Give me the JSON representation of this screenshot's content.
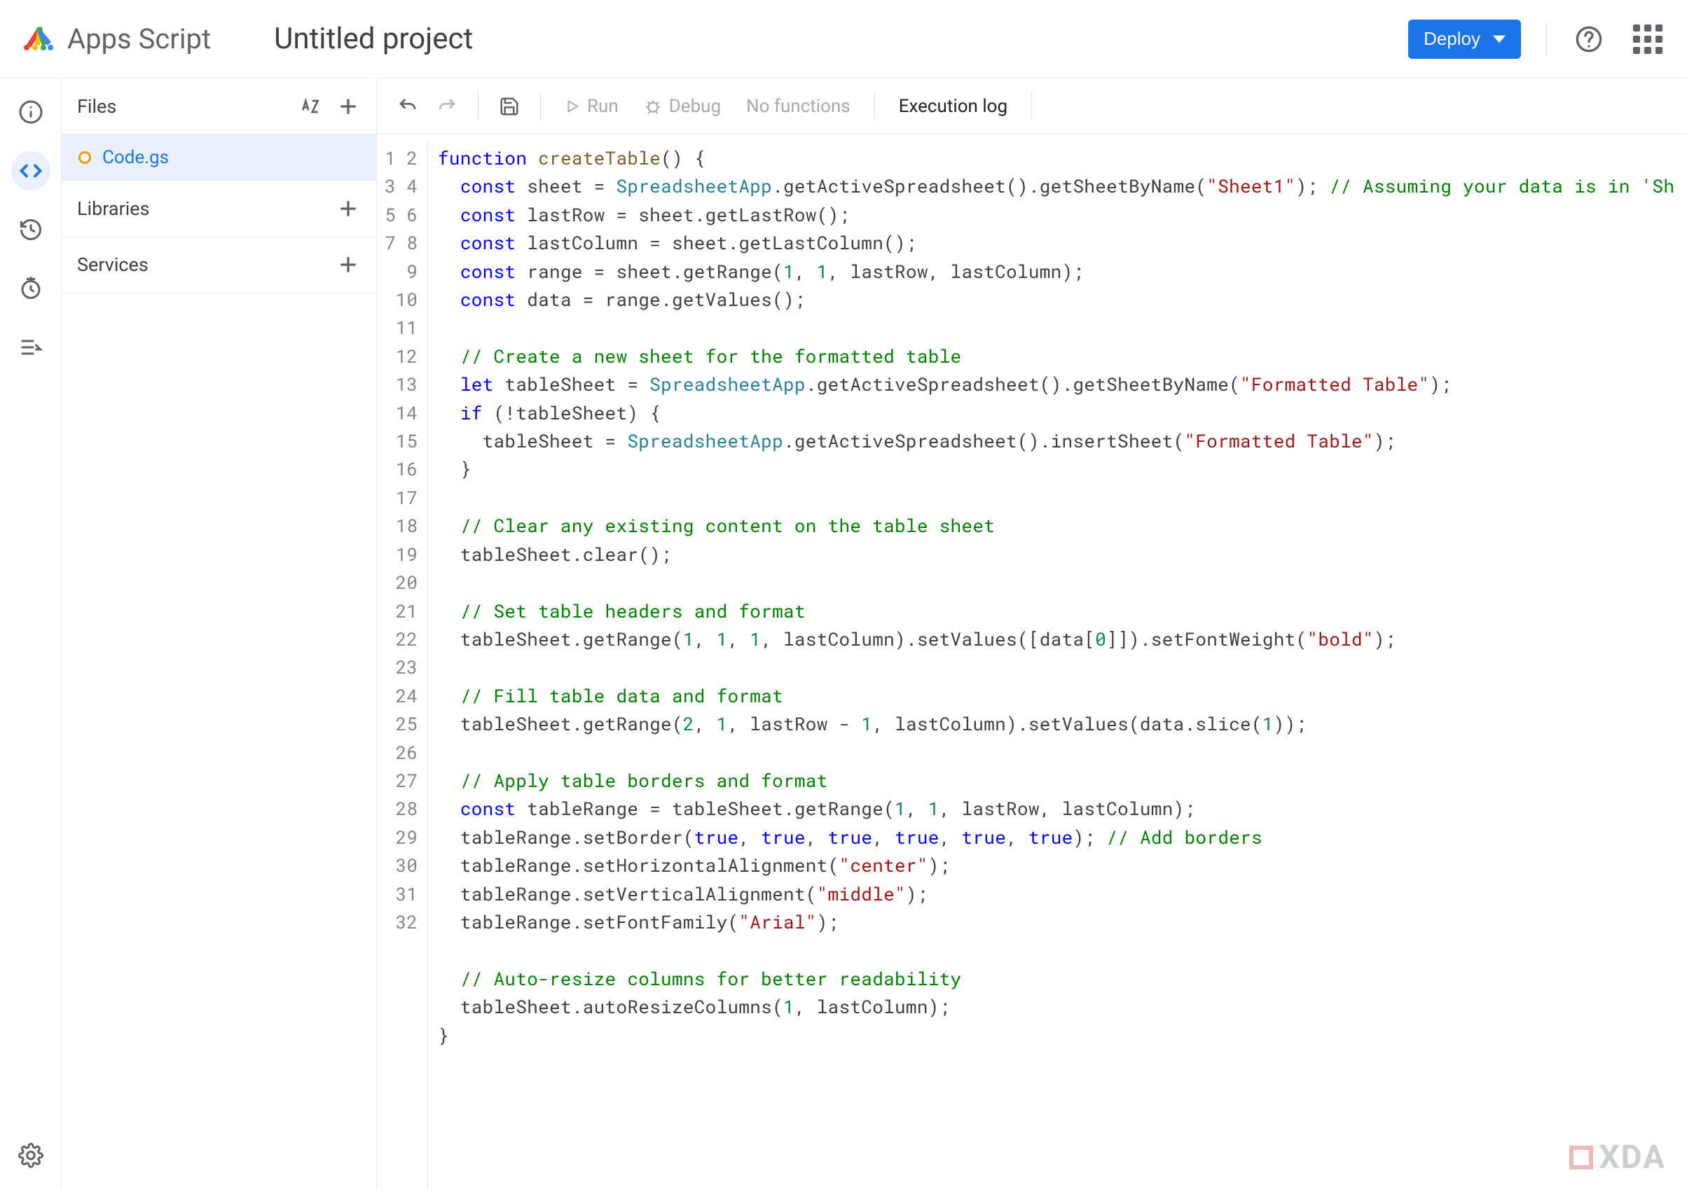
{
  "header": {
    "product_name": "Apps Script",
    "project_title": "Untitled project",
    "deploy_label": "Deploy"
  },
  "files_panel": {
    "files_label": "Files",
    "libraries_label": "Libraries",
    "services_label": "Services",
    "active_file": "Code.gs"
  },
  "toolbar": {
    "run_label": "Run",
    "debug_label": "Debug",
    "functions_label": "No functions",
    "exec_log_label": "Execution log"
  },
  "rail": {
    "info": "info-icon",
    "editor": "code-icon",
    "history": "history-icon",
    "triggers": "clock-icon",
    "executions": "executions-icon",
    "settings": "gear-icon"
  },
  "code": {
    "line_count": 32,
    "lines": [
      [
        {
          "t": "function",
          "c": "kw"
        },
        {
          "t": " "
        },
        {
          "t": "createTable",
          "c": "fn"
        },
        {
          "t": "() {",
          "c": "pun"
        }
      ],
      [
        {
          "t": "  "
        },
        {
          "t": "const",
          "c": "kw"
        },
        {
          "t": " sheet = "
        },
        {
          "t": "SpreadsheetApp",
          "c": "type"
        },
        {
          "t": ".getActiveSpreadsheet().getSheetByName("
        },
        {
          "t": "\"Sheet1\"",
          "c": "str"
        },
        {
          "t": "); "
        },
        {
          "t": "// Assuming your data is in 'Sh",
          "c": "cmt"
        }
      ],
      [
        {
          "t": "  "
        },
        {
          "t": "const",
          "c": "kw"
        },
        {
          "t": " lastRow = sheet.getLastRow();"
        }
      ],
      [
        {
          "t": "  "
        },
        {
          "t": "const",
          "c": "kw"
        },
        {
          "t": " lastColumn = sheet.getLastColumn();"
        }
      ],
      [
        {
          "t": "  "
        },
        {
          "t": "const",
          "c": "kw"
        },
        {
          "t": " range = sheet.getRange("
        },
        {
          "t": "1",
          "c": "num"
        },
        {
          "t": ", "
        },
        {
          "t": "1",
          "c": "num"
        },
        {
          "t": ", lastRow, lastColumn);"
        }
      ],
      [
        {
          "t": "  "
        },
        {
          "t": "const",
          "c": "kw"
        },
        {
          "t": " data = range.getValues();"
        }
      ],
      [
        {
          "t": ""
        }
      ],
      [
        {
          "t": "  "
        },
        {
          "t": "// Create a new sheet for the formatted table",
          "c": "cmt"
        }
      ],
      [
        {
          "t": "  "
        },
        {
          "t": "let",
          "c": "kw"
        },
        {
          "t": " tableSheet = "
        },
        {
          "t": "SpreadsheetApp",
          "c": "type"
        },
        {
          "t": ".getActiveSpreadsheet().getSheetByName("
        },
        {
          "t": "\"Formatted Table\"",
          "c": "str"
        },
        {
          "t": ");"
        }
      ],
      [
        {
          "t": "  "
        },
        {
          "t": "if",
          "c": "kw"
        },
        {
          "t": " (!tableSheet) {"
        }
      ],
      [
        {
          "t": "    tableSheet = "
        },
        {
          "t": "SpreadsheetApp",
          "c": "type"
        },
        {
          "t": ".getActiveSpreadsheet().insertSheet("
        },
        {
          "t": "\"Formatted Table\"",
          "c": "str"
        },
        {
          "t": ");"
        }
      ],
      [
        {
          "t": "  }"
        }
      ],
      [
        {
          "t": ""
        }
      ],
      [
        {
          "t": "  "
        },
        {
          "t": "// Clear any existing content on the table sheet",
          "c": "cmt"
        }
      ],
      [
        {
          "t": "  tableSheet.clear();"
        }
      ],
      [
        {
          "t": ""
        }
      ],
      [
        {
          "t": "  "
        },
        {
          "t": "// Set table headers and format",
          "c": "cmt"
        }
      ],
      [
        {
          "t": "  tableSheet.getRange("
        },
        {
          "t": "1",
          "c": "num"
        },
        {
          "t": ", "
        },
        {
          "t": "1",
          "c": "num"
        },
        {
          "t": ", "
        },
        {
          "t": "1",
          "c": "num"
        },
        {
          "t": ", lastColumn).setValues([data["
        },
        {
          "t": "0",
          "c": "num"
        },
        {
          "t": "]]).setFontWeight("
        },
        {
          "t": "\"bold\"",
          "c": "str"
        },
        {
          "t": ");"
        }
      ],
      [
        {
          "t": ""
        }
      ],
      [
        {
          "t": "  "
        },
        {
          "t": "// Fill table data and format",
          "c": "cmt"
        }
      ],
      [
        {
          "t": "  tableSheet.getRange("
        },
        {
          "t": "2",
          "c": "num"
        },
        {
          "t": ", "
        },
        {
          "t": "1",
          "c": "num"
        },
        {
          "t": ", lastRow - "
        },
        {
          "t": "1",
          "c": "num"
        },
        {
          "t": ", lastColumn).setValues(data.slice("
        },
        {
          "t": "1",
          "c": "num"
        },
        {
          "t": "));"
        }
      ],
      [
        {
          "t": ""
        }
      ],
      [
        {
          "t": "  "
        },
        {
          "t": "// Apply table borders and format",
          "c": "cmt"
        }
      ],
      [
        {
          "t": "  "
        },
        {
          "t": "const",
          "c": "kw"
        },
        {
          "t": " tableRange = tableSheet.getRange("
        },
        {
          "t": "1",
          "c": "num"
        },
        {
          "t": ", "
        },
        {
          "t": "1",
          "c": "num"
        },
        {
          "t": ", lastRow, lastColumn);"
        }
      ],
      [
        {
          "t": "  tableRange.setBorder("
        },
        {
          "t": "true",
          "c": "kw"
        },
        {
          "t": ", "
        },
        {
          "t": "true",
          "c": "kw"
        },
        {
          "t": ", "
        },
        {
          "t": "true",
          "c": "kw"
        },
        {
          "t": ", "
        },
        {
          "t": "true",
          "c": "kw"
        },
        {
          "t": ", "
        },
        {
          "t": "true",
          "c": "kw"
        },
        {
          "t": ", "
        },
        {
          "t": "true",
          "c": "kw"
        },
        {
          "t": "); "
        },
        {
          "t": "// Add borders",
          "c": "cmt"
        }
      ],
      [
        {
          "t": "  tableRange.setHorizontalAlignment("
        },
        {
          "t": "\"center\"",
          "c": "str"
        },
        {
          "t": ");"
        }
      ],
      [
        {
          "t": "  tableRange.setVerticalAlignment("
        },
        {
          "t": "\"middle\"",
          "c": "str"
        },
        {
          "t": ");"
        }
      ],
      [
        {
          "t": "  tableRange.setFontFamily("
        },
        {
          "t": "\"Arial\"",
          "c": "str"
        },
        {
          "t": ");"
        }
      ],
      [
        {
          "t": ""
        }
      ],
      [
        {
          "t": "  "
        },
        {
          "t": "// Auto-resize columns for better readability",
          "c": "cmt"
        }
      ],
      [
        {
          "t": "  tableSheet.autoResizeColumns("
        },
        {
          "t": "1",
          "c": "num"
        },
        {
          "t": ", lastColumn);"
        }
      ],
      [
        {
          "t": "}"
        }
      ]
    ]
  },
  "watermark": {
    "text": "XDA"
  }
}
